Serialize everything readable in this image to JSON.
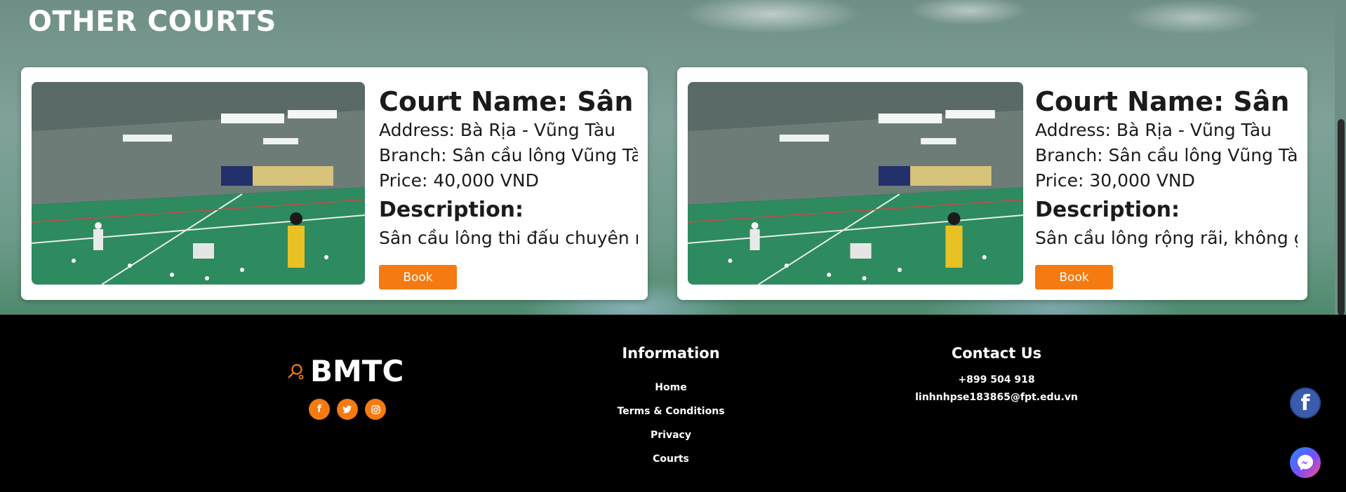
{
  "section": {
    "title": "OTHER COURTS"
  },
  "courts": [
    {
      "name": "Court Name: Sân cầ",
      "address": "Address: Bà Rịa - Vũng Tàu",
      "branch": "Branch: Sân cầu lông Vũng Tàu",
      "price": "Price: 40,000 VND",
      "description_heading": "Description:",
      "description": "Sân cầu lông thi đấu chuyên ng",
      "book_label": "Book"
    },
    {
      "name": "Court Name: Sân cầu",
      "address": "Address: Bà Rịa - Vũng Tàu",
      "branch": "Branch: Sân cầu lông Vũng Tàu",
      "price": "Price: 30,000 VND",
      "description_heading": "Description:",
      "description": "Sân cầu lông rộng rãi, không gi",
      "book_label": "Book"
    }
  ],
  "footer": {
    "brand": "BMTC",
    "socials": [
      "facebook-icon",
      "twitter-icon",
      "instagram-icon"
    ],
    "information": {
      "heading": "Information",
      "links": [
        "Home",
        "Terms & Conditions",
        "Privacy",
        "Courts"
      ]
    },
    "contact": {
      "heading": "Contact Us",
      "phone": "+899 504 918",
      "email": "linhnhpse183865@fpt.edu.vn"
    }
  },
  "colors": {
    "accent": "#f47a11",
    "footer_bg": "#000000",
    "facebook": "#3b5cad"
  }
}
